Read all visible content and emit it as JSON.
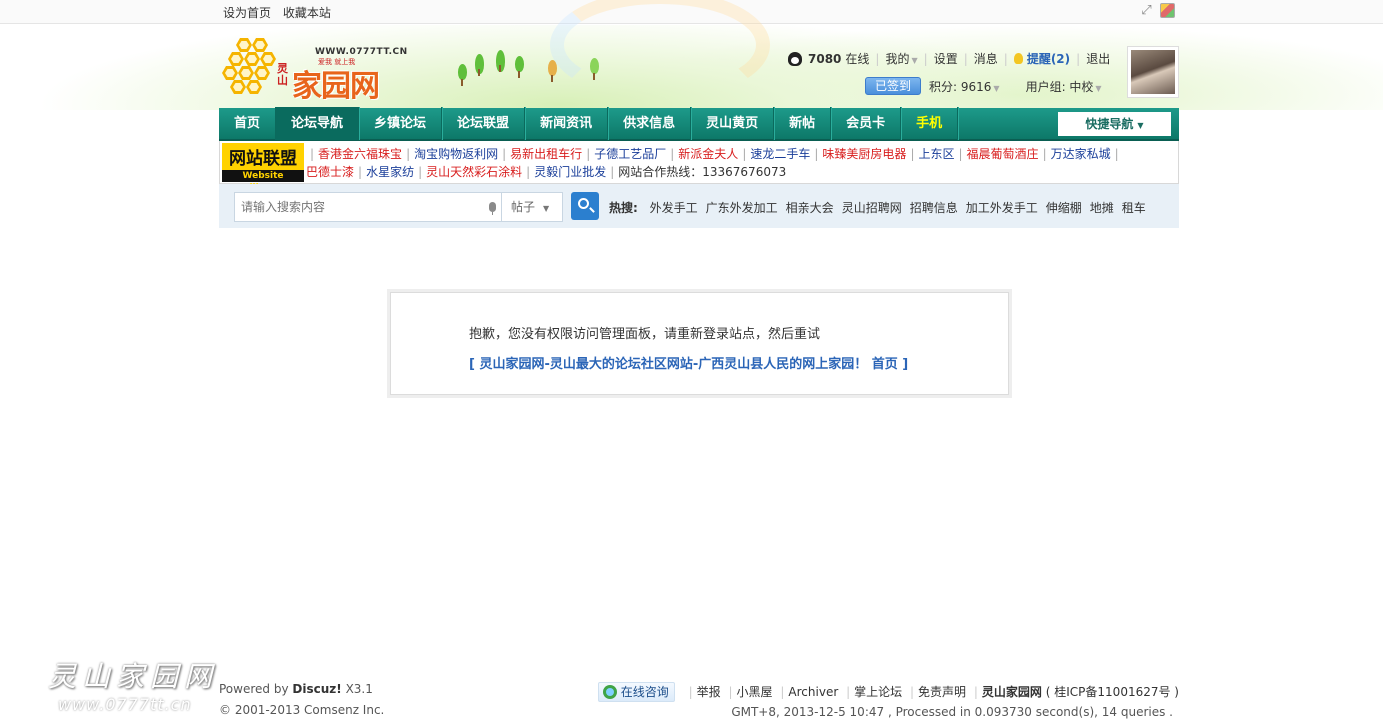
{
  "toptb": {
    "links": [
      "设为首页",
      "收藏本站"
    ]
  },
  "logo": {
    "url": "WWW.0777TT.CN",
    "slogan": "爱我 就上我",
    "region": "灵山",
    "name": "家园网"
  },
  "user": {
    "online_count": "7080",
    "online_label": "在线",
    "menu": [
      "我的",
      "设置",
      "消息"
    ],
    "remind": "提醒(2)",
    "logout": "退出",
    "signed": "已签到",
    "points": "积分: 9616",
    "group": "用户组: 中校"
  },
  "nav": {
    "items": [
      "首页",
      "论坛导航",
      "乡镇论坛",
      "论坛联盟",
      "新闻资讯",
      "供求信息",
      "灵山黄页",
      "新帖",
      "会员卡",
      "手机"
    ],
    "quick": "快捷导航"
  },
  "alliance": {
    "badge_cn": "网站联盟",
    "badge_en": "Website alliance",
    "links": [
      {
        "text": "香港金六福珠宝",
        "color": "red"
      },
      {
        "text": "淘宝购物返利网",
        "color": "blue"
      },
      {
        "text": "易新出租车行",
        "color": "red"
      },
      {
        "text": "子德工艺品厂",
        "color": "blue"
      },
      {
        "text": "新派金夫人",
        "color": "red"
      },
      {
        "text": "速龙二手车",
        "color": "blue"
      },
      {
        "text": "味臻美厨房电器",
        "color": "red"
      },
      {
        "text": "上东区",
        "color": "blue"
      },
      {
        "text": "福晨葡萄酒庄",
        "color": "red"
      },
      {
        "text": "万达家私城",
        "color": "blue"
      },
      {
        "text": "巴德士漆",
        "color": "red"
      },
      {
        "text": "水星家纺",
        "color": "blue"
      },
      {
        "text": "灵山天然彩石涂料",
        "color": "red"
      },
      {
        "text": "灵毅门业批发",
        "color": "blue"
      },
      {
        "text": "网站合作热线：13367676073",
        "color": "grey"
      }
    ]
  },
  "search": {
    "placeholder": "请输入搜索内容",
    "type": "帖子",
    "hot_label": "热搜:",
    "hot": [
      "外发手工",
      "广东外发加工",
      "相亲大会",
      "灵山招聘网",
      "招聘信息",
      "加工外发手工",
      "伸缩棚",
      "地摊",
      "租车"
    ]
  },
  "message": {
    "text": "抱歉，您没有权限访问管理面板，请重新登录站点，然后重试",
    "back_link": "[ 灵山家园网-灵山最大的论坛社区网站-广西灵山县人民的网上家园！ 首页 ]"
  },
  "watermark": {
    "title": "灵山家园网",
    "url": "www.0777tt.cn"
  },
  "footer": {
    "powered_prefix": "Powered by",
    "powered_name": "Discuz!",
    "powered_version": "X3.1",
    "copyright": "© 2001-2013 Comsenz Inc.",
    "consult": "在线咨询",
    "links": [
      "举报",
      "小黑屋",
      "Archiver",
      "掌上论坛",
      "免责声明"
    ],
    "site_name": "灵山家园网",
    "icp": "( 桂ICP备11001627号 )",
    "processed": "GMT+8, 2013-12-5 10:47 , Processed in 0.093730 second(s), 14 queries ."
  },
  "colors": {
    "nav_bg": "#138a7a",
    "link_blue": "#2b65b7",
    "alliance_red": "#d81e1e",
    "alliance_blue": "#1b3f9a",
    "badge_yellow": "#ffd200"
  }
}
